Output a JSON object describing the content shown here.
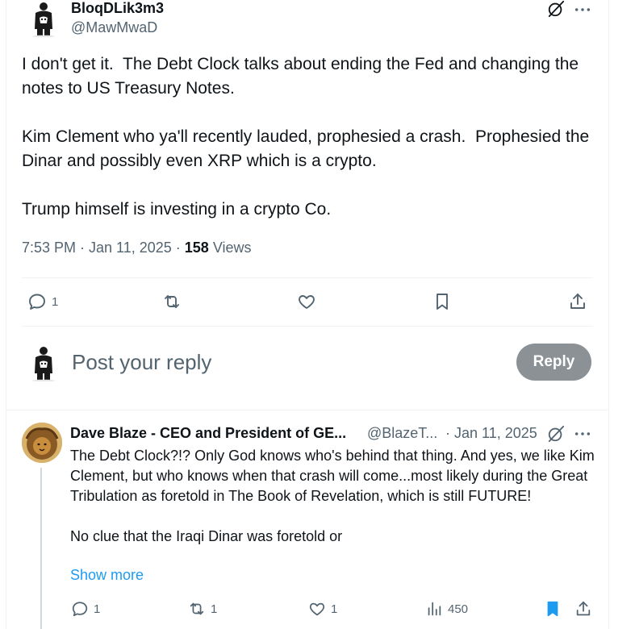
{
  "tweet": {
    "display_name": "BloqDLik3m3",
    "handle": "@MawMwaD",
    "body": "I don't get it.  The Debt Clock talks about ending the Fed and changing the notes to US Treasury Notes.\n\nKim Clement who ya'll recently lauded, prophesied a crash.  Prophesied the Dinar and possibly even XRP which is a crypto.\n\nTrump himself is investing in a crypto Co.",
    "time": "7:53 PM · Jan 11, 2025 · ",
    "views_count": "158",
    "views_label": " Views",
    "actions": {
      "reply_count": "1",
      "retweet_count": "",
      "like_count": "",
      "bookmark_count": ""
    }
  },
  "reply_composer": {
    "placeholder": "Post your reply",
    "button_label": "Reply"
  },
  "reply": {
    "display_name": "Dave Blaze - CEO and President of GE...",
    "handle": "@BlazeT...",
    "date": "· Jan 11, 2025",
    "body": "The Debt Clock?!? Only God knows who's behind that thing. And yes, we like Kim Clement, but who knows when that crash will come...most likely during the Great Tribulation as foretold in The Book of Revelation, which is still FUTURE!\n\nNo clue that the Iraqi Dinar was foretold or",
    "show_more": "Show more",
    "actions": {
      "reply_count": "1",
      "retweet_count": "1",
      "like_count": "1",
      "views_count": "450"
    }
  },
  "colors": {
    "text_primary": "#0f1419",
    "text_secondary": "#536471",
    "link": "#1d9bf0",
    "reply_button_disabled": "#8b9195",
    "bookmark_active": "#1d9bf0"
  },
  "icons": [
    "grok-icon",
    "more-icon",
    "reply-icon",
    "retweet-icon",
    "like-icon",
    "bookmark-icon",
    "share-icon",
    "views-icon"
  ]
}
